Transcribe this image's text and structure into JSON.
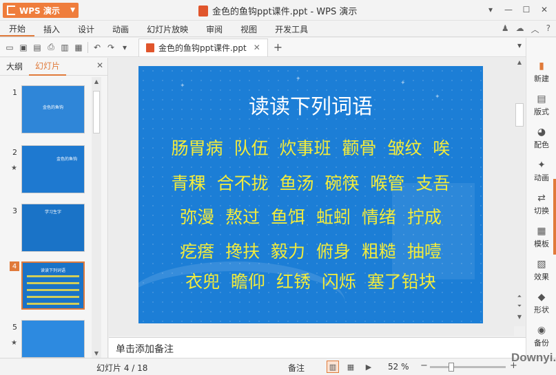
{
  "app": {
    "brand_label": "WPS 演示",
    "window_title": "金色的鱼钩ppt课件.ppt - WPS 演示",
    "colors": {
      "accent": "#e07a3a",
      "slide_bg": "#1c7ed6",
      "word_color": "#f3ec3b"
    }
  },
  "menu": {
    "items": [
      "开始",
      "插入",
      "设计",
      "动画",
      "幻灯片放映",
      "审阅",
      "视图",
      "开发工具"
    ],
    "active_index": 0
  },
  "toolbar": {
    "doc_tab_label": "金色的鱼钩ppt课件.ppt"
  },
  "left_panel": {
    "tabs": [
      "大纲",
      "幻灯片"
    ],
    "active_tab": 1,
    "thumbnails": [
      {
        "number": "1",
        "title": "金色的鱼钩"
      },
      {
        "number": "2",
        "title": "金色的鱼钩"
      },
      {
        "number": "3",
        "title": "学习生字"
      },
      {
        "number": "4",
        "title": "读读下列词语"
      },
      {
        "number": "5",
        "title": ""
      }
    ],
    "selected_marker": "4"
  },
  "slide": {
    "title": "读读下列词语",
    "lines": [
      "肠胃病 队伍 炊事班 颧骨 皱纹 唉",
      "青稞 合不拢 鱼汤 碗筷 喉管 支吾",
      "弥漫 熬过 鱼饵 蚯蚓 情绪 拧成",
      "疙瘩 搀扶 毅力 俯身 粗糙 抽噎",
      "衣兜 瞻仰 红锈 闪烁 塞了铅块"
    ]
  },
  "notes": {
    "placeholder": "单击添加备注"
  },
  "right_bar": {
    "items": [
      {
        "label": "新建",
        "icon": "new-slide-icon"
      },
      {
        "label": "版式",
        "icon": "layout-icon"
      },
      {
        "label": "配色",
        "icon": "palette-icon"
      },
      {
        "label": "动画",
        "icon": "animation-icon"
      },
      {
        "label": "切换",
        "icon": "transition-icon"
      },
      {
        "label": "模板",
        "icon": "template-icon"
      },
      {
        "label": "效果",
        "icon": "effect-icon"
      },
      {
        "label": "形状",
        "icon": "shape-icon"
      },
      {
        "label": "备份",
        "icon": "backup-icon"
      }
    ]
  },
  "status": {
    "slide_indicator": "幻灯片 4 / 18",
    "notes_label": "备注",
    "zoom_label": "52 %",
    "zoom_percent": 52
  },
  "watermark": "Downyi.com"
}
